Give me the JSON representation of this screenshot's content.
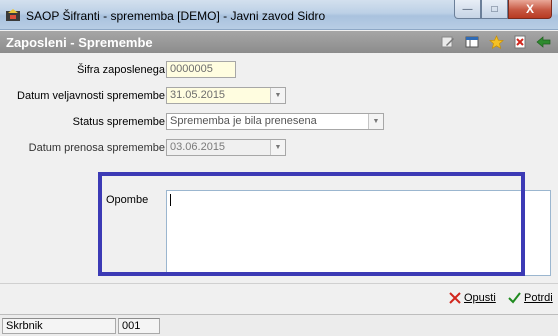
{
  "window": {
    "title": "SAOP Šifranti - sprememba [DEMO] - Javni zavod Sidro",
    "minimize_label": "—",
    "maximize_label": "□",
    "close_label": "X"
  },
  "header": {
    "title": "Zaposleni - Spremembe",
    "tools": [
      "edit-icon",
      "columns-icon",
      "favorite-star-icon",
      "delete-icon",
      "exit-icon"
    ]
  },
  "form": {
    "sifra_label": "Šifra zaposlenega",
    "sifra_value": "0000005",
    "datum_veljavnosti_label": "Datum veljavnosti spremembe",
    "datum_veljavnosti_value": "31.05.2015",
    "status_label": "Status spremembe",
    "status_value": "Sprememba je bila prenesena",
    "datum_prenosa_label": "Datum prenosa spremembe",
    "datum_prenosa_value": "03.06.2015",
    "opombe_label": "Opombe",
    "opombe_value": ""
  },
  "actions": {
    "cancel_label": "Opusti",
    "confirm_label": "Potrdi"
  },
  "statusbar": {
    "cell1": "Skrbnik",
    "cell2": "001"
  },
  "colors": {
    "header_bg": "#999999",
    "highlight_border": "#3c3ab5",
    "required_field_bg": "#fffde0"
  }
}
